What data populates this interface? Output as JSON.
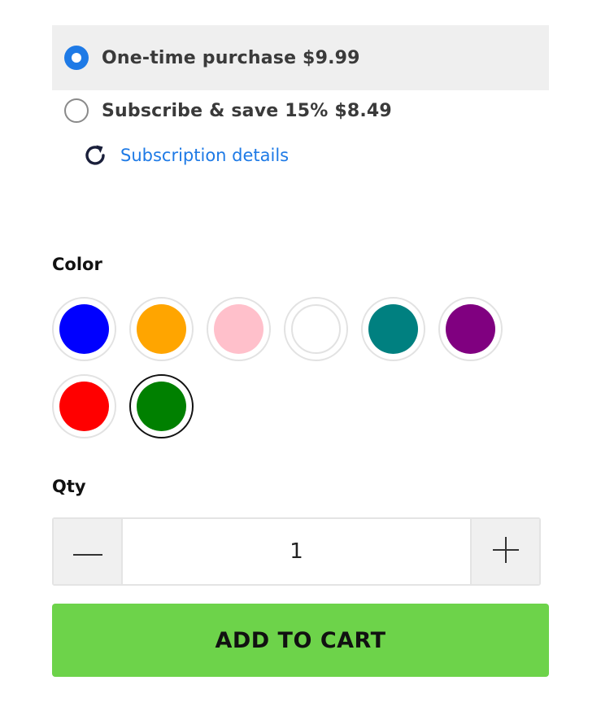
{
  "purchase_options": {
    "one_time": {
      "label": "One-time purchase $9.99",
      "selected": true
    },
    "subscribe": {
      "label": "Subscribe & save 15% $8.49",
      "selected": false
    },
    "details_link": "Subscription details"
  },
  "color": {
    "label": "Color",
    "swatches": [
      {
        "name": "blue",
        "hex": "#0000ff"
      },
      {
        "name": "orange",
        "hex": "#ffa500"
      },
      {
        "name": "pink",
        "hex": "#ffc0cb"
      },
      {
        "name": "white",
        "hex": "#ffffff"
      },
      {
        "name": "teal",
        "hex": "#008080"
      },
      {
        "name": "purple",
        "hex": "#800080"
      },
      {
        "name": "red",
        "hex": "#ff0000"
      },
      {
        "name": "green",
        "hex": "#008000"
      }
    ],
    "selected": "green"
  },
  "quantity": {
    "label": "Qty",
    "value": "1",
    "decrement_icon": "minus-icon",
    "increment_icon": "plus-icon"
  },
  "cart": {
    "button_label": "ADD TO CART",
    "button_color": "#6dd34a"
  },
  "colors": {
    "accent": "#1e7ae6",
    "selected_bg": "#efefef"
  },
  "icons": {
    "subscription": "refresh-icon"
  }
}
